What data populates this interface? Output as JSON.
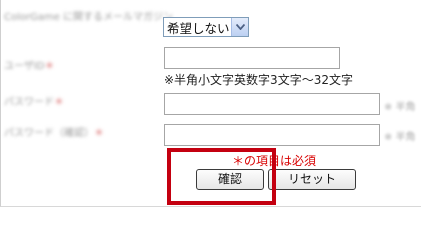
{
  "form": {
    "rows": [
      {
        "label": "ColorGame に関するメールマガジン",
        "required": false
      },
      {
        "label": "ユーザID",
        "required": true
      },
      {
        "label": "パスワード",
        "required": true
      },
      {
        "label": "パスワード（確認）",
        "required": true
      }
    ],
    "required_mark": "＊",
    "mailmag_select": {
      "value": "希望しない"
    },
    "userid_hint": "※半角小文字英数字3文字～32文字",
    "password_side_hint": "※ 半角",
    "password_confirm_side_hint": "※ 半角",
    "required_note": "＊の項目は必須",
    "confirm_button": "確認",
    "reset_button": "リセット"
  },
  "colors": {
    "required_red": "#d80000",
    "highlight_red": "#c40010"
  }
}
